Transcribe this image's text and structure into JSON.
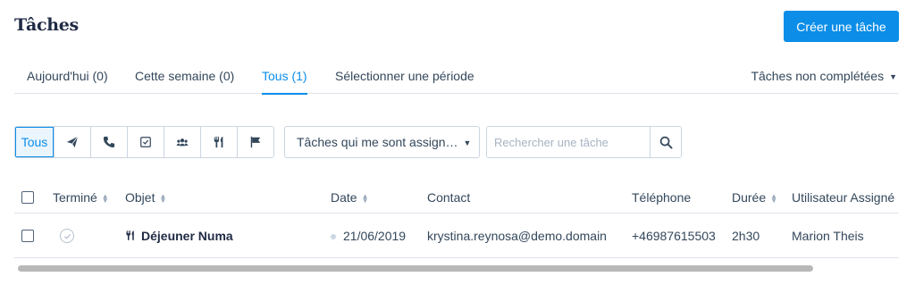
{
  "header": {
    "title": "Tâches",
    "create_button": "Créer une tâche"
  },
  "tabs": [
    {
      "label": "Aujourd'hui (0)"
    },
    {
      "label": "Cette semaine (0)"
    },
    {
      "label": "Tous (1)",
      "active": true
    },
    {
      "label": "Sélectionner une période"
    }
  ],
  "status_filter": {
    "label": "Tâches non complétées"
  },
  "type_filters": {
    "all_label": "Tous",
    "icons": [
      "send-icon",
      "phone-icon",
      "checkbox-task-icon",
      "users-icon",
      "utensils-icon",
      "flag-icon"
    ]
  },
  "assignment_filter": {
    "label": "Tâches qui me sont assign…"
  },
  "search": {
    "placeholder": "Rechercher une tâche"
  },
  "table": {
    "columns": {
      "done": "Terminé",
      "subject": "Objet",
      "date": "Date",
      "contact": "Contact",
      "phone": "Téléphone",
      "duration": "Durée",
      "assignee": "Utilisateur Assigné"
    },
    "rows": [
      {
        "subject": "Déjeuner Numa",
        "date": "21/06/2019",
        "contact": "krystina.reynosa@demo.domain",
        "phone": "+46987615503",
        "duration": "2h30",
        "assignee": "Marion Theis"
      }
    ]
  },
  "colors": {
    "accent": "#0b8de8",
    "text": "#33475b",
    "title": "#1f2a44",
    "border": "#cbd6e2"
  }
}
